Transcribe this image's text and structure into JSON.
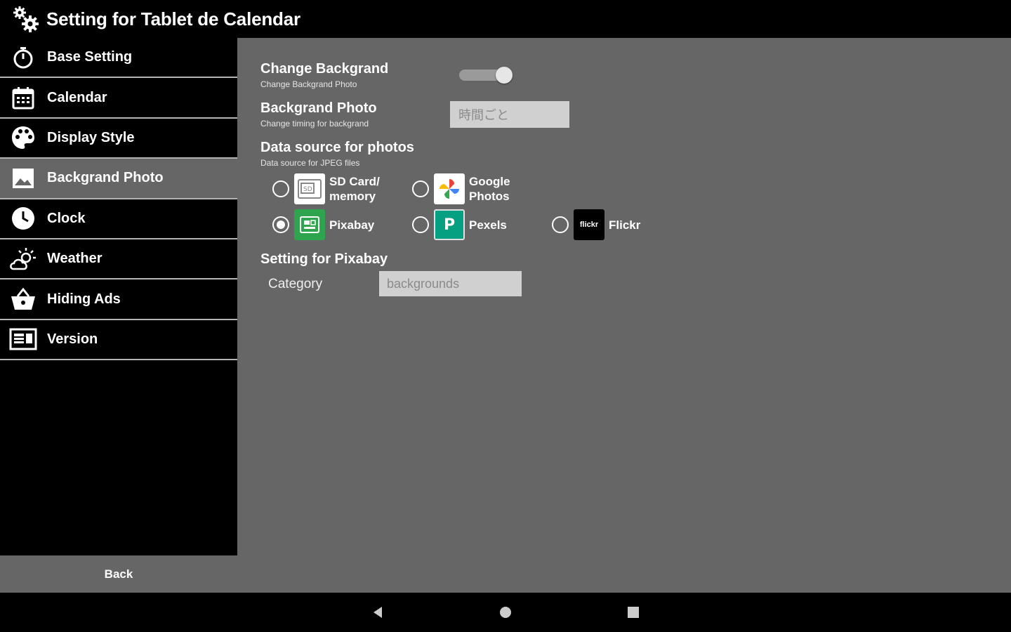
{
  "header": {
    "title": "Setting for Tablet de Calendar",
    "icon": "gears-icon"
  },
  "sidebar": {
    "items": [
      {
        "label": "Base Setting",
        "icon": "stopwatch-icon"
      },
      {
        "label": "Calendar",
        "icon": "calendar-icon"
      },
      {
        "label": "Display Style",
        "icon": "palette-icon"
      },
      {
        "label": "Backgrand Photo",
        "icon": "image-icon",
        "active": true
      },
      {
        "label": "Clock",
        "icon": "clock-icon"
      },
      {
        "label": "Weather",
        "icon": "weather-icon"
      },
      {
        "label": "Hiding Ads",
        "icon": "basket-icon"
      },
      {
        "label": "Version",
        "icon": "version-icon"
      }
    ],
    "back_label": "Back"
  },
  "settings": {
    "change_background": {
      "title": "Change Backgrand",
      "sub": "Change Backgrand Photo",
      "enabled": true
    },
    "background_photo": {
      "title": "Backgrand Photo",
      "sub": "Change timing for backgrand",
      "value": "時間ごと"
    },
    "data_source": {
      "title": "Data source for photos",
      "sub": "Data source for JPEG files",
      "options": [
        {
          "label": "SD Card/\nmemory",
          "logo_text": "SD",
          "checked": false
        },
        {
          "label": "Google\nPhotos",
          "logo_text": "",
          "checked": false
        },
        {
          "label": "Pixabay",
          "logo_text": "",
          "checked": true
        },
        {
          "label": "Pexels",
          "logo_text": "P",
          "checked": false
        },
        {
          "label": "Flickr",
          "logo_text": "flickr",
          "checked": false
        }
      ]
    },
    "pixabay": {
      "title": "Setting for Pixabay",
      "category_label": "Category",
      "category_value": "backgrounds"
    }
  },
  "colors": {
    "panel": "#666666",
    "sidebar": "#000000",
    "pixabay_green": "#2ea44f",
    "pexels_teal": "#05a081"
  }
}
